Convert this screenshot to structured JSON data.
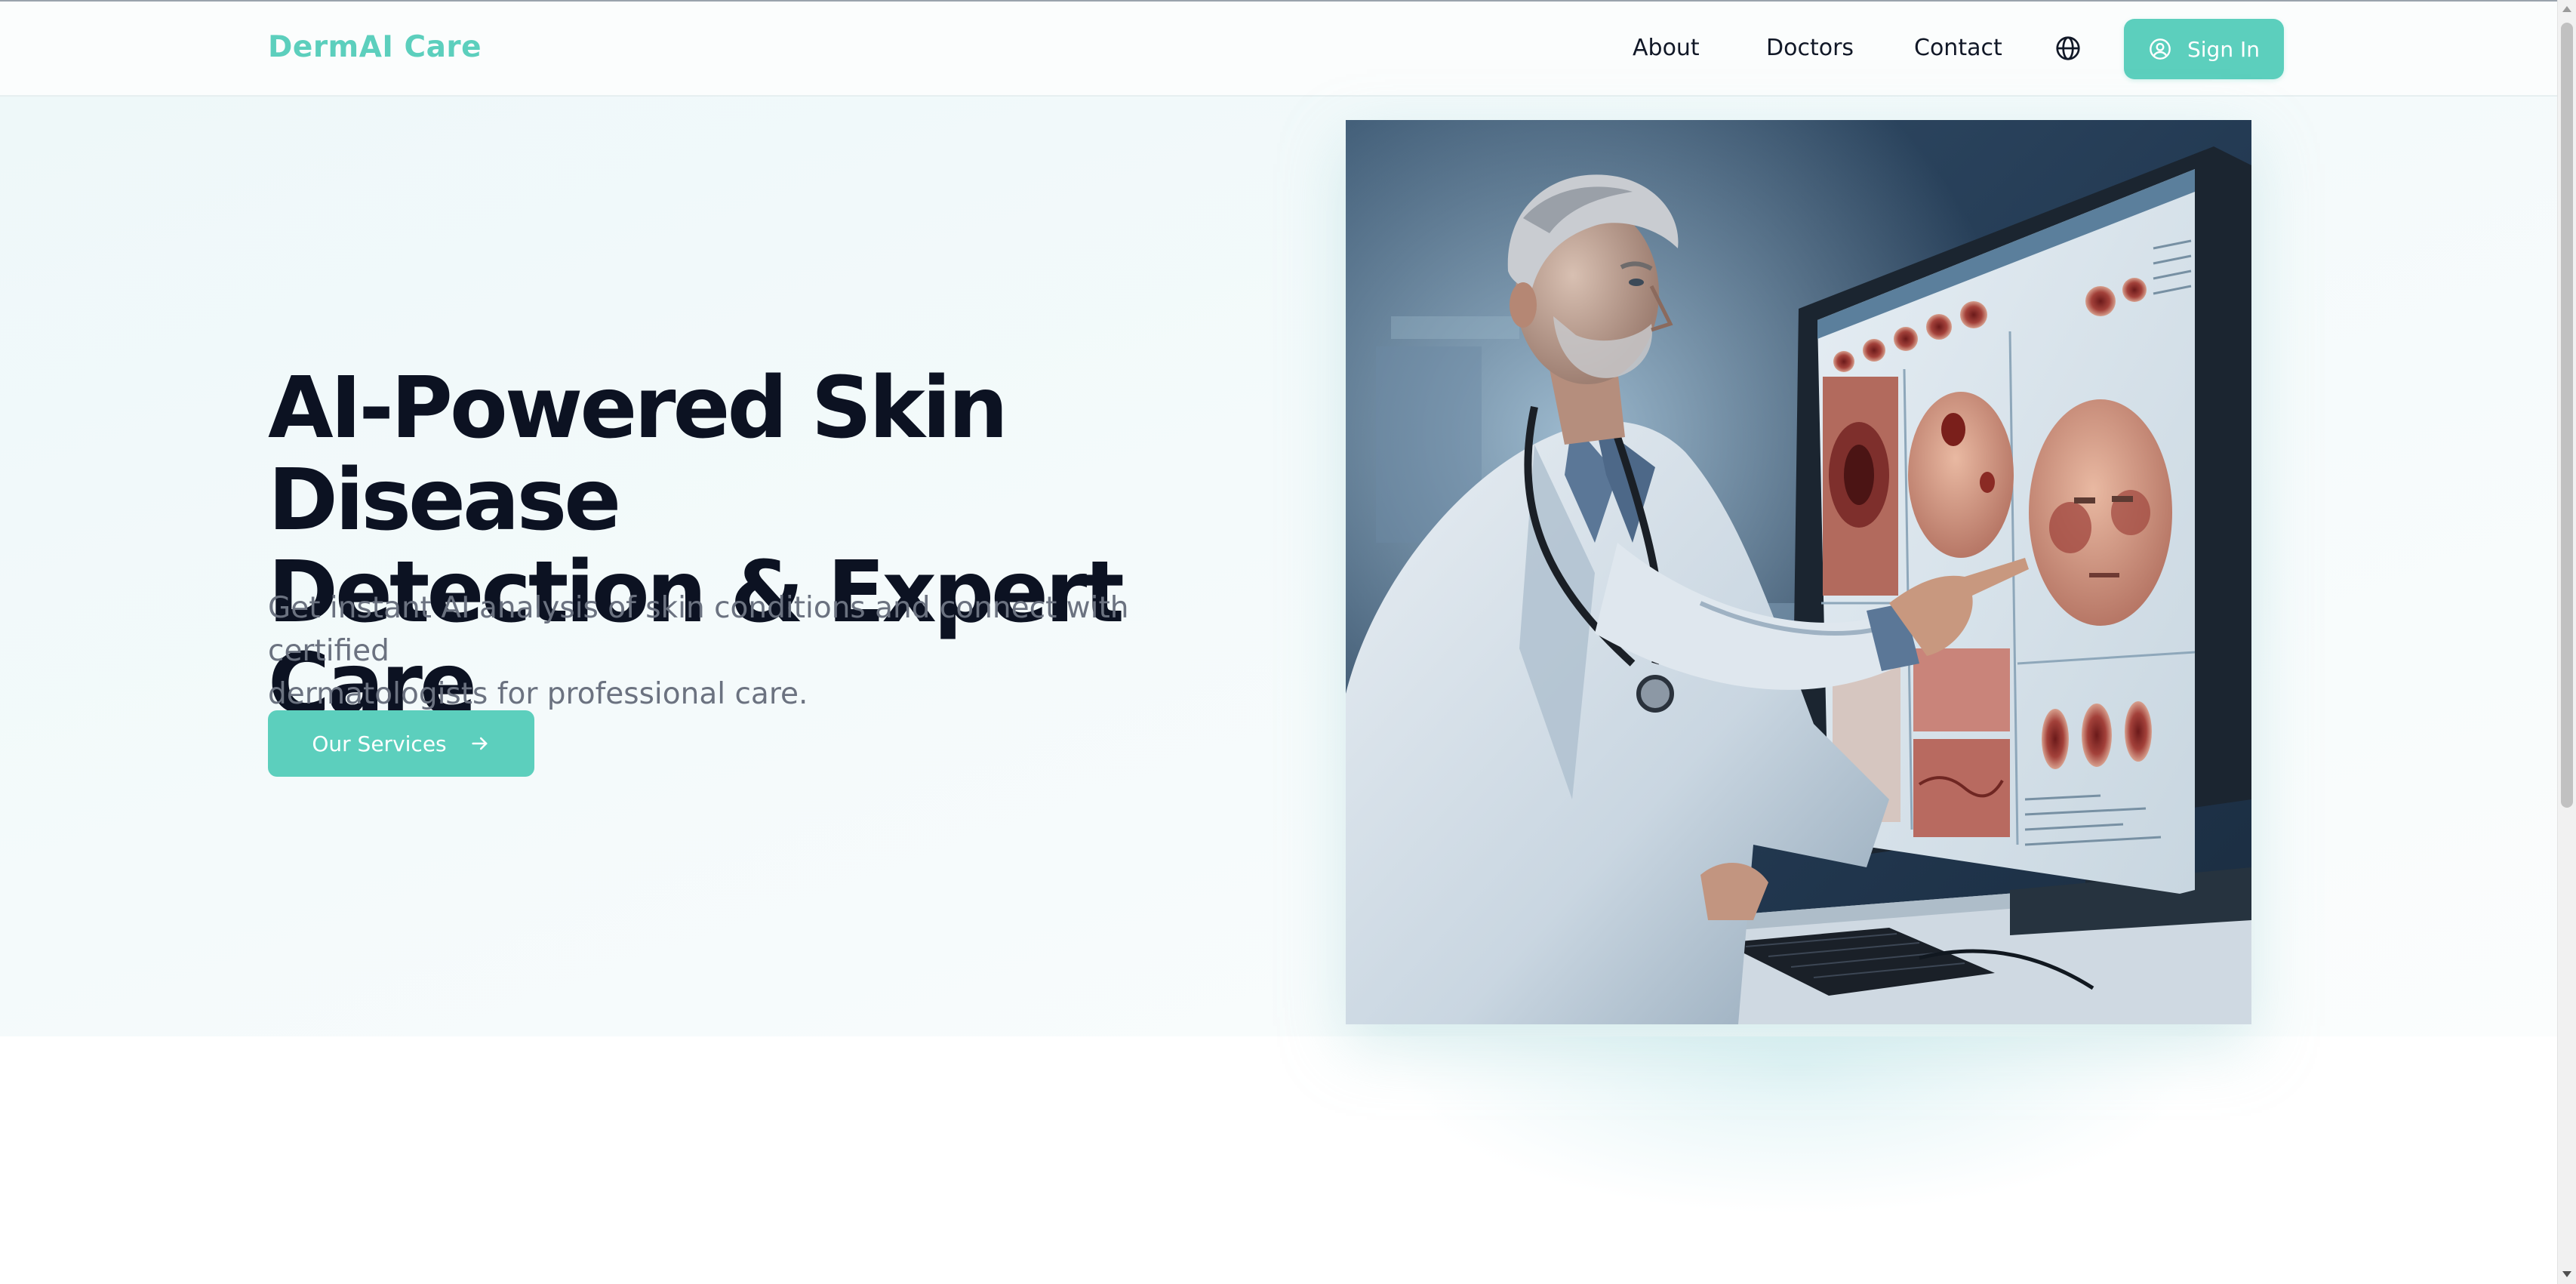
{
  "header": {
    "brand": "DermAI Care",
    "nav": {
      "about": "About",
      "doctors": "Doctors",
      "contact": "Contact"
    },
    "language_icon": "globe-icon",
    "signin_icon": "user-circle-icon",
    "signin_label": "Sign In"
  },
  "hero": {
    "title_line1": "AI-Powered Skin Disease",
    "title_line2": "Detection & Expert Care",
    "subtitle_line1": "Get instant AI analysis of skin conditions and connect with certified",
    "subtitle_line2": "dermatologists for professional care.",
    "cta_label": "Our Services",
    "cta_icon": "arrow-right-icon"
  },
  "colors": {
    "accent": "#5ccfbd",
    "heading": "#0c1222",
    "body_text": "#6b7280",
    "nav_text": "#111827"
  }
}
